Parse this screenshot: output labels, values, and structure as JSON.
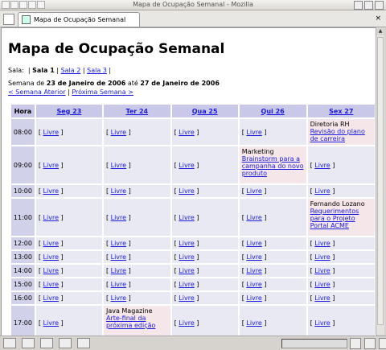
{
  "window": {
    "title": "Mapa de Ocupação Semanal - Mozilla",
    "tab_label": "Mapa de Ocupação Semanal",
    "close_glyph": "×"
  },
  "page": {
    "heading": "Mapa de Ocupação Semanal",
    "sala_label": "Sala:",
    "salas": [
      "Sala 1",
      "Sala 2",
      "Sala 3"
    ],
    "semana_prefix": "Semana de",
    "semana_start": "23 de Janeiro de 2006",
    "semana_mid": "até",
    "semana_end": "27 de Janeiro de 2006",
    "prev_link": "< Semana Aterior",
    "next_link": "Próxima Semana >"
  },
  "table": {
    "hora_header": "Hora",
    "days": [
      "Seg 23",
      "Ter 24",
      "Qua 25",
      "Qui 26",
      "Sex 27"
    ],
    "free_label": "Livre",
    "rows": [
      {
        "hora": "08:00",
        "cells": [
          null,
          null,
          null,
          null,
          {
            "dept": "Diretoria RH",
            "topic": "Revisão do plano de carreira"
          }
        ]
      },
      {
        "hora": "09:00",
        "cells": [
          null,
          null,
          null,
          {
            "dept": "Marketing",
            "topic": "Brainstorm para a campanha do novo produto"
          },
          null
        ]
      },
      {
        "hora": "10:00",
        "cells": [
          null,
          null,
          null,
          null,
          null
        ]
      },
      {
        "hora": "11:00",
        "cells": [
          null,
          null,
          null,
          null,
          {
            "dept": "Fernando Lozano",
            "topic": "Requerimentos para o Projeto Portal ACME"
          }
        ]
      },
      {
        "hora": "12:00",
        "cells": [
          null,
          null,
          null,
          null,
          null
        ]
      },
      {
        "hora": "13:00",
        "cells": [
          null,
          null,
          null,
          null,
          null
        ]
      },
      {
        "hora": "14:00",
        "cells": [
          null,
          null,
          null,
          null,
          null
        ]
      },
      {
        "hora": "15:00",
        "cells": [
          null,
          null,
          null,
          null,
          null
        ]
      },
      {
        "hora": "16:00",
        "cells": [
          null,
          null,
          null,
          null,
          null
        ]
      },
      {
        "hora": "17:00",
        "cells": [
          null,
          {
            "dept": "Java Magazine",
            "topic": "Arte-final da próxima edição"
          },
          null,
          null,
          null
        ]
      }
    ]
  },
  "colors": {
    "header_bg": "#c9c8e8",
    "cell_bg": "#e9e9f3",
    "busy_bg": "#f5e6e9",
    "link": "#1b1be0"
  }
}
